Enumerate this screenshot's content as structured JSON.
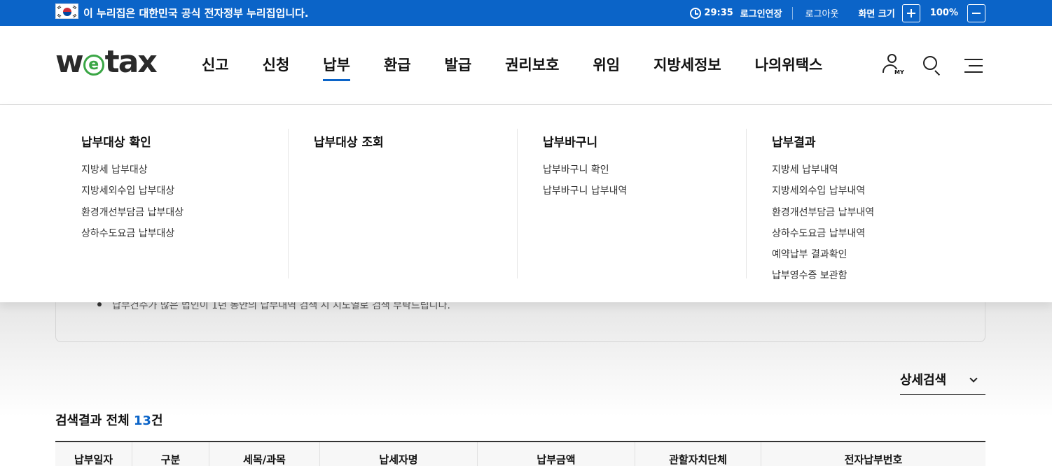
{
  "gov_banner": {
    "text": "이 누리집은 대한민국 공식 전자정부 누리집입니다.",
    "timer": "29:35",
    "extend_label": "로그인연장",
    "logout_label": "로그아웃",
    "zoom_label": "화면 크기",
    "zoom_value": "100%"
  },
  "header": {
    "logo": {
      "w": "w",
      "e": "e",
      "rest": "tax"
    },
    "nav": [
      "신고",
      "신청",
      "납부",
      "환급",
      "발급",
      "권리보호",
      "위임",
      "지방세정보",
      "나의위택스"
    ],
    "active_nav": "납부",
    "my_label": "MY"
  },
  "mega_menu": {
    "columns": [
      {
        "title": "납부대상 확인",
        "links": [
          "지방세 납부대상",
          "지방세외수입 납부대상",
          "환경개선부담금 납부대상",
          "상하수도요금 납부대상"
        ]
      },
      {
        "title": "납부대상 조회",
        "links": []
      },
      {
        "title": "납부바구니",
        "links": [
          "납부바구니 확인",
          "납부바구니 납부내역"
        ]
      },
      {
        "title": "납부결과",
        "links": [
          "지방세 납부내역",
          "지방세외수입 납부내역",
          "환경개선부담금 납부내역",
          "상하수도요금 납부내역",
          "예약납부 결과확인",
          "납부영수증 보관함"
        ]
      }
    ]
  },
  "content": {
    "notice_text": "납부건수가 많은 법인이 1년 동안의 납부내역 검색 시 지도열로 검색 부탁드립니다.",
    "detail_search_label": "상세검색",
    "result_prefix": "검색결과 전체 ",
    "result_count": "13",
    "result_suffix": "건",
    "table_headers": [
      "납부일자",
      "구분",
      "세목/과목",
      "납세자명",
      "납부금액",
      "관할자치단체",
      "전자납부번호"
    ]
  },
  "colors": {
    "brand_blue": "#0b64c8",
    "logo_green": "#3aa645"
  }
}
